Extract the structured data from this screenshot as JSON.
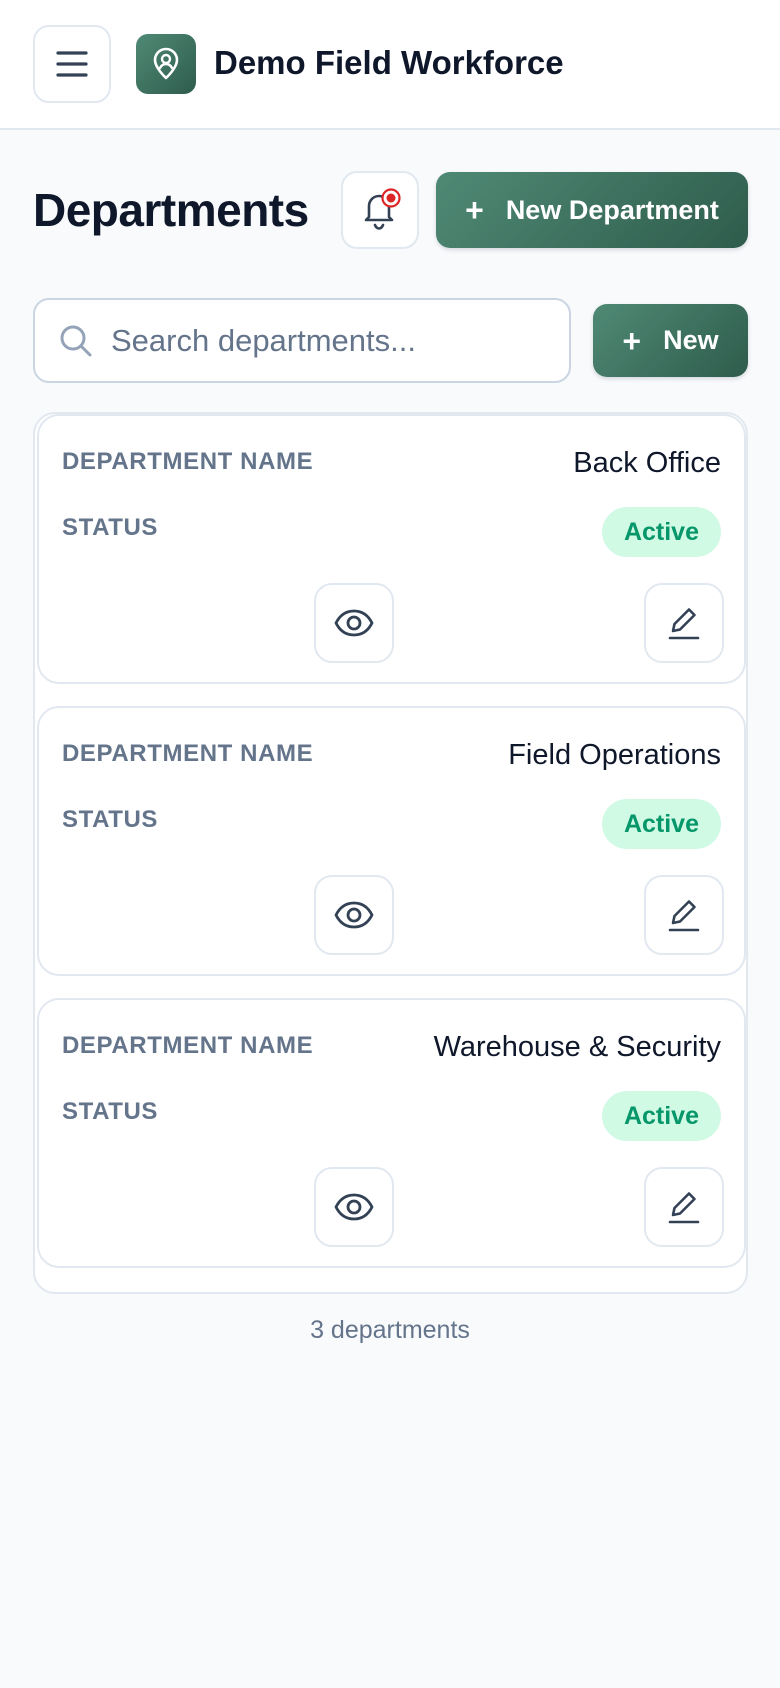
{
  "header": {
    "app_title": "Demo Field Workforce",
    "menu_icon": "hamburger-menu-icon",
    "logo_icon": "map-pin-user-icon"
  },
  "page": {
    "title": "Departments",
    "notification_icon": "bell-icon",
    "new_department_label": "New Department",
    "new_label": "New",
    "plus_symbol": "+"
  },
  "search": {
    "placeholder": "Search departments...",
    "value": ""
  },
  "columns": {
    "name_label": "DEPARTMENT NAME",
    "status_label": "STATUS"
  },
  "departments": [
    {
      "name": "Back Office",
      "status": "Active"
    },
    {
      "name": "Field Operations",
      "status": "Active"
    },
    {
      "name": "Warehouse & Security",
      "status": "Active"
    }
  ],
  "footer": {
    "count_text": "3 departments"
  },
  "colors": {
    "brand": "#3f7462",
    "status_active_bg": "#d1fae5",
    "status_active_text": "#059669",
    "notification_dot": "#dc2626"
  }
}
